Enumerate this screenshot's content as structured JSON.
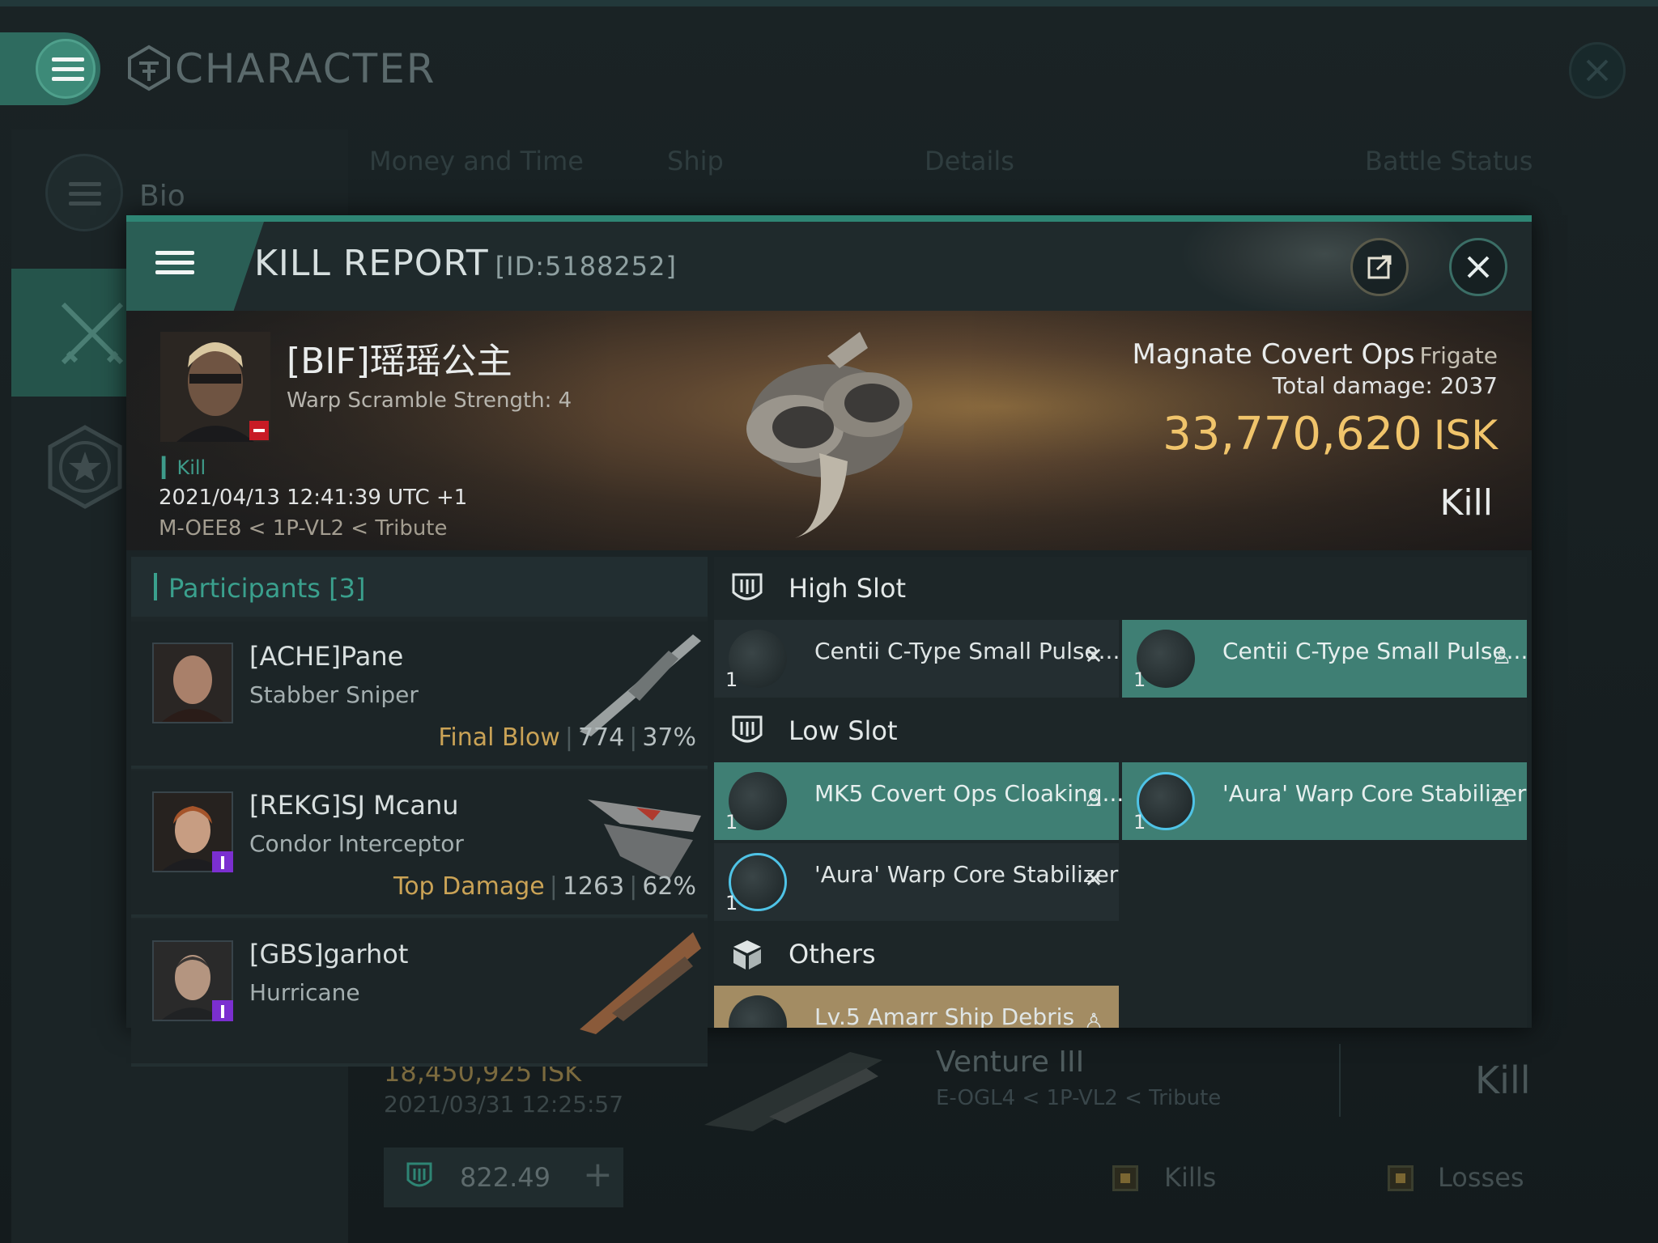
{
  "window": {
    "title": "CHARACTER",
    "sidebar": {
      "bio_label": "Bio"
    },
    "tabs": [
      "Money and Time",
      "Ship",
      "Details",
      "Battle Status"
    ]
  },
  "background_kill": {
    "isk": "18,450,925 ISK",
    "date": "2021/03/31 12:25:57",
    "ship": "Venture III",
    "location": "E-OGL4 < 1P-VL2 < Tribute",
    "result": "Kill"
  },
  "footer": {
    "value": "822.49",
    "kills_label": "Kills",
    "losses_label": "Losses"
  },
  "kill_report": {
    "title": "KILL REPORT",
    "id": "[ID:5188252]",
    "victim": {
      "name": "[BIF]瑶瑶公主",
      "subtitle": "Warp Scramble Strength: 4",
      "tag": "Kill",
      "datetime": "2021/04/13 12:41:39 UTC +1",
      "location": "M-OEE8 < 1P-VL2 < Tribute",
      "ship_name": "Magnate Covert Ops",
      "ship_class": "Frigate",
      "total_damage": "Total damage:  2037",
      "isk_value": "33,770,620",
      "isk_unit": "ISK",
      "result": "Kill"
    },
    "participants": {
      "title": "Participants",
      "count": "[3]",
      "list": [
        {
          "name": "[ACHE]Pane",
          "ship": "Stabber Sniper",
          "label": "Final Blow",
          "damage": "774",
          "percent": "37%"
        },
        {
          "name": "[REKG]SJ Mcanu",
          "ship": "Condor Interceptor",
          "label": "Top Damage",
          "damage": "1263",
          "percent": "62%"
        },
        {
          "name": "[GBS]garhot",
          "ship": "Hurricane",
          "label": "",
          "damage": "",
          "percent": ""
        }
      ]
    },
    "fitting": {
      "high_slot": {
        "label": "High Slot",
        "items": [
          {
            "name": "Centii C-Type Small Pulse...",
            "qty": "1",
            "status": "destroyed"
          },
          {
            "name": "Centii C-Type Small Pulse...",
            "qty": "1",
            "status": "dropped"
          }
        ]
      },
      "low_slot": {
        "label": "Low Slot",
        "items": [
          {
            "name": "MK5 Covert Ops Cloaking...",
            "qty": "1",
            "status": "dropped"
          },
          {
            "name": "'Aura' Warp Core Stabilizer",
            "qty": "1",
            "status": "dropped"
          },
          {
            "name": "'Aura' Warp Core Stabilizer",
            "qty": "1",
            "status": "destroyed"
          }
        ]
      },
      "others": {
        "label": "Others",
        "items": [
          {
            "name": "Lv.5 Amarr Ship Debris",
            "qty": "",
            "status": "dropped"
          }
        ]
      }
    }
  },
  "colors": {
    "accent_teal": "#3aa08d",
    "isk_gold": "#f0c46b",
    "final_blow": "#caa356",
    "dropped_item_bg": "#3f7f74",
    "destroyed_badge": "#c81b25"
  }
}
